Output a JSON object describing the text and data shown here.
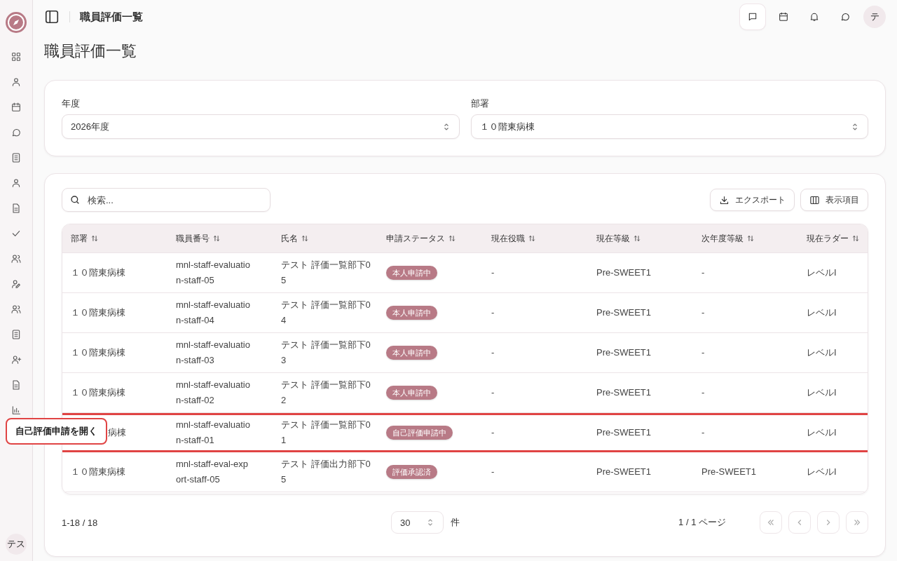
{
  "header": {
    "title": "職員評価一覧",
    "avatar": "テ"
  },
  "page_title": "職員評価一覧",
  "filters": [
    {
      "label": "年度",
      "value": "2026年度"
    },
    {
      "label": "部署",
      "value": "１０階東病棟"
    }
  ],
  "search": {
    "placeholder": "検索..."
  },
  "toolbar_buttons": [
    {
      "kind": "export",
      "label": "エクスポート"
    },
    {
      "kind": "columns",
      "label": "表示項目"
    }
  ],
  "table": {
    "columns": [
      "部署",
      "職員番号",
      "氏名",
      "申請ステータス",
      "現在役職",
      "現在等級",
      "次年度等級",
      "現在ラダー"
    ],
    "rows": [
      {
        "highlighted": false,
        "cells": [
          "１０階東病棟",
          "mnl-staff-evaluation-staff-05",
          "テスト 評価一覧部下05",
          "本人申請中",
          "-",
          "Pre-SWEET1",
          "-",
          "レベルI"
        ]
      },
      {
        "highlighted": false,
        "cells": [
          "１０階東病棟",
          "mnl-staff-evaluation-staff-04",
          "テスト 評価一覧部下04",
          "本人申請中",
          "-",
          "Pre-SWEET1",
          "-",
          "レベルI"
        ]
      },
      {
        "highlighted": false,
        "cells": [
          "１０階東病棟",
          "mnl-staff-evaluation-staff-03",
          "テスト 評価一覧部下03",
          "本人申請中",
          "-",
          "Pre-SWEET1",
          "-",
          "レベルI"
        ]
      },
      {
        "highlighted": false,
        "cells": [
          "１０階東病棟",
          "mnl-staff-evaluation-staff-02",
          "テスト 評価一覧部下02",
          "本人申請中",
          "-",
          "Pre-SWEET1",
          "-",
          "レベルI"
        ]
      },
      {
        "highlighted": true,
        "tooltip": "自己評価申請を開く",
        "cells": [
          "病棟",
          "mnl-staff-evaluation-staff-01",
          "テスト 評価一覧部下01",
          "自己評価申請中",
          "-",
          "Pre-SWEET1",
          "-",
          "レベルI"
        ]
      },
      {
        "highlighted": false,
        "cells": [
          "１０階東病棟",
          "mnl-staff-eval-export-staff-05",
          "テスト 評価出力部下05",
          "評価承認済",
          "-",
          "Pre-SWEET1",
          "Pre-SWEET1",
          "レベルI"
        ]
      }
    ]
  },
  "pagination": {
    "range": "1-18 / 18",
    "page_size": "30",
    "unit": "件",
    "page": "1 / 1 ページ"
  },
  "sidebar": {
    "avatar": "テス"
  }
}
